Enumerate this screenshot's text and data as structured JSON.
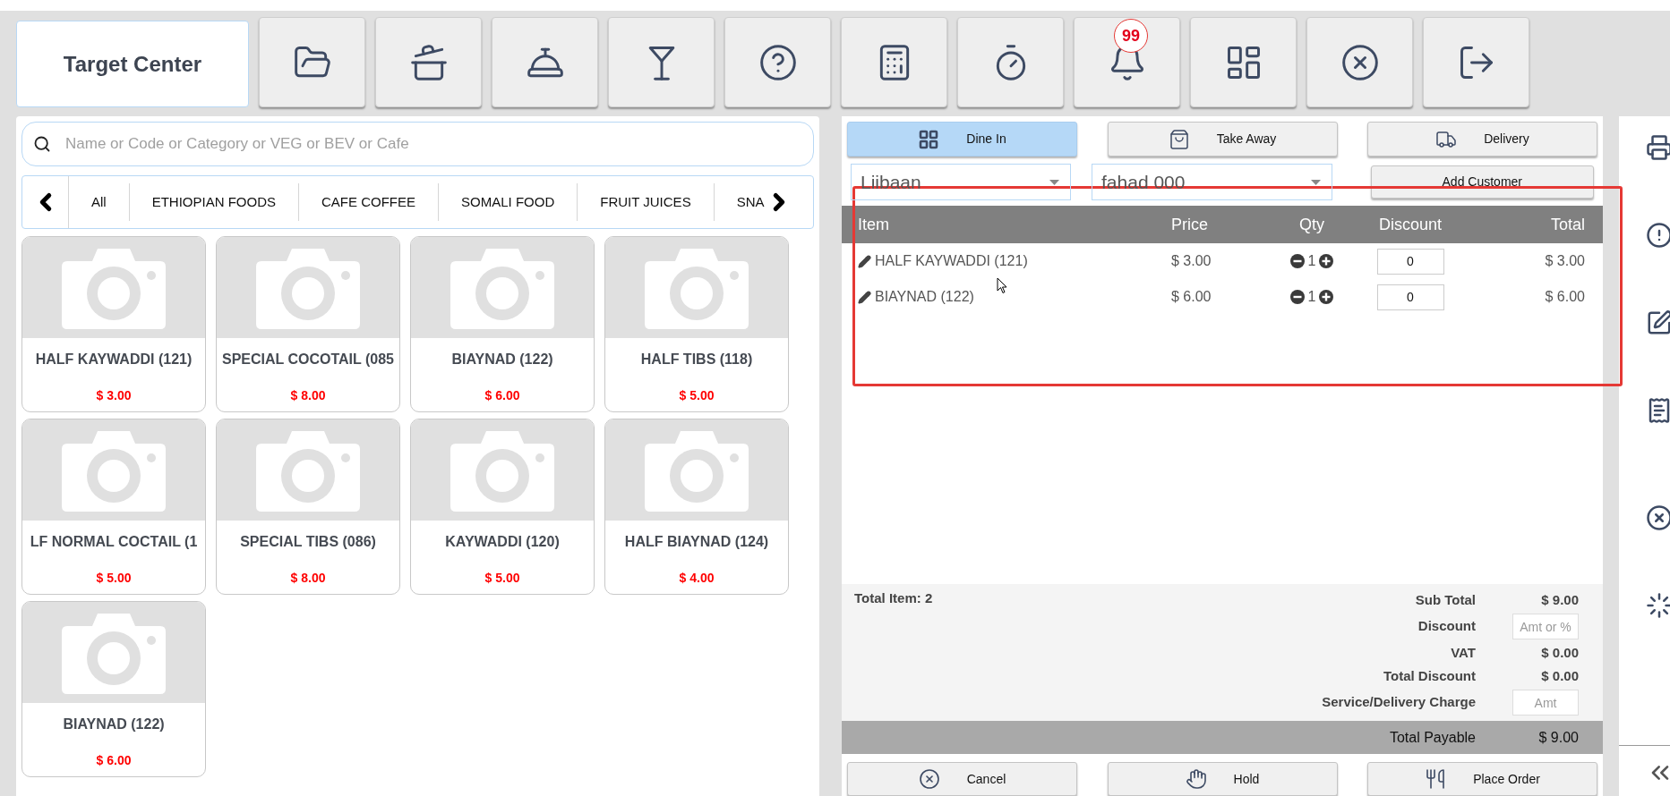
{
  "toolbar": {
    "title": "Target Center",
    "buttons": [
      {
        "kind": "folder"
      },
      {
        "kind": "kitchen"
      },
      {
        "kind": "waiter"
      },
      {
        "kind": "cocktail"
      },
      {
        "kind": "help"
      },
      {
        "kind": "calculator"
      },
      {
        "kind": "timer"
      },
      {
        "kind": "bell",
        "badge": "99"
      },
      {
        "kind": "layout"
      },
      {
        "kind": "close"
      },
      {
        "kind": "logout"
      }
    ]
  },
  "search": {
    "placeholder": "Name or Code or Category or VEG or BEV or Cafe"
  },
  "categories": [
    {
      "label": "All"
    },
    {
      "label": "ETHIOPIAN FOODS"
    },
    {
      "label": "CAFE COFFEE"
    },
    {
      "label": "SOMALI FOOD"
    },
    {
      "label": "FRUIT JUICES"
    },
    {
      "label": "SNA"
    }
  ],
  "products": [
    {
      "name": "HALF KAYWADDI (121)",
      "price": "$ 3.00"
    },
    {
      "name": "SPECIAL COCOTAIL (085",
      "price": "$ 8.00"
    },
    {
      "name": "BIAYNAD (122)",
      "price": "$ 6.00"
    },
    {
      "name": "HALF TIBS (118)",
      "price": "$ 5.00"
    },
    {
      "name": "LF NORMAL COCTAIL (1",
      "price": "$ 5.00"
    },
    {
      "name": "SPECIAL TIBS (086)",
      "price": "$ 8.00"
    },
    {
      "name": "KAYWADDI (120)",
      "price": "$ 5.00"
    },
    {
      "name": "HALF BIAYNAD (124)",
      "price": "$ 4.00"
    },
    {
      "name": "BIAYNAD (122)",
      "price": "$ 6.00"
    }
  ],
  "order_types": [
    {
      "label": "Dine In",
      "kind": "dine_in",
      "selected": true
    },
    {
      "label": "Take Away",
      "kind": "take_away",
      "selected": false
    },
    {
      "label": "Delivery",
      "kind": "delivery",
      "selected": false
    }
  ],
  "customer_fields": [
    {
      "value": "Liibaan"
    },
    {
      "value": "fahad 000"
    }
  ],
  "add_customer": "Add Customer",
  "table": {
    "columns": [
      "Item",
      "Price",
      "Qty",
      "Discount",
      "Total"
    ],
    "rows": [
      {
        "item": "HALF KAYWADDI (121)",
        "price": "$ 3.00",
        "qty": "1",
        "discount": "0",
        "total": "$ 3.00"
      },
      {
        "item": "BIAYNAD (122)",
        "price": "$ 6.00",
        "qty": "1",
        "discount": "0",
        "total": "$ 6.00"
      }
    ]
  },
  "summary": {
    "total_items": "Total Item: 2",
    "lines": [
      {
        "label": "Sub Total",
        "kind": "value",
        "value": "$ 9.00"
      },
      {
        "label": "Discount",
        "kind": "input",
        "placeholder": "Amt or %"
      },
      {
        "label": "VAT",
        "kind": "value",
        "value": "$ 0.00"
      },
      {
        "label": "Total Discount",
        "kind": "value",
        "value": "$ 0.00"
      },
      {
        "label": "Service/Delivery Charge",
        "kind": "input",
        "placeholder": "Amt"
      }
    ],
    "total_payable": {
      "label": "Total Payable",
      "value": "$ 9.00"
    }
  },
  "actions": [
    {
      "label": "Cancel",
      "kind": "cancel"
    },
    {
      "label": "Hold",
      "kind": "hold"
    },
    {
      "label": "Place Order",
      "kind": "place_order"
    }
  ],
  "sidebar": [
    {
      "kind": "print"
    },
    {
      "kind": "alert"
    },
    {
      "kind": "edit"
    },
    {
      "kind": "receipt"
    },
    {
      "kind": "close"
    },
    {
      "kind": "loading"
    }
  ]
}
